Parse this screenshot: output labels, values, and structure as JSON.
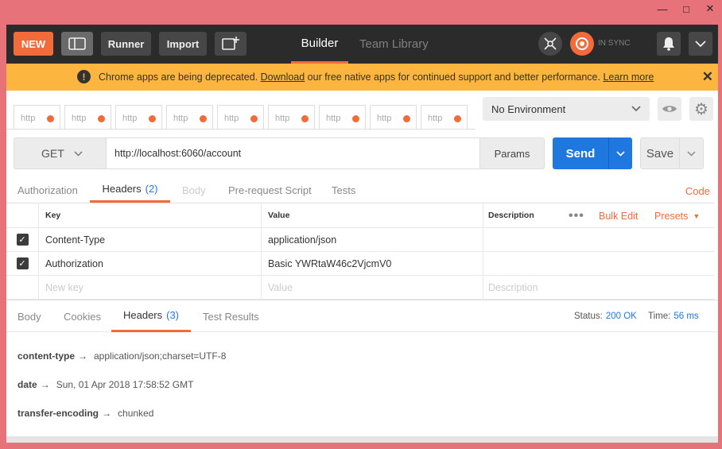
{
  "window": {
    "minimize": "—",
    "maximize": "□",
    "close": "✕"
  },
  "topbar": {
    "new_label": "NEW",
    "runner_label": "Runner",
    "import_label": "Import",
    "tabs": [
      "Builder",
      "Team Library"
    ],
    "sync_label": "IN SYNC"
  },
  "banner": {
    "text_before": "Chrome apps are being deprecated. ",
    "link_download": "Download",
    "text_middle": " our free native apps for continued support and better performance. ",
    "link_learn": "Learn more"
  },
  "request_tabs": [
    "http",
    "http",
    "http",
    "http",
    "http",
    "http",
    "http",
    "http",
    "http"
  ],
  "environment": {
    "selected": "No Environment"
  },
  "request": {
    "method": "GET",
    "url": "http://localhost:6060/account",
    "params_label": "Params",
    "send_label": "Send",
    "save_label": "Save"
  },
  "request_sections": {
    "authorization": "Authorization",
    "headers": "Headers",
    "headers_count": "(2)",
    "body": "Body",
    "prerequest": "Pre-request Script",
    "tests": "Tests",
    "code": "Code"
  },
  "headers_table": {
    "col_key": "Key",
    "col_value": "Value",
    "col_description": "Description",
    "more": "•••",
    "bulk_edit": "Bulk Edit",
    "presets": "Presets",
    "rows": [
      {
        "key": "Content-Type",
        "value": "application/json",
        "description": ""
      },
      {
        "key": "Authorization",
        "value": "Basic YWRtaW46c2VjcmV0",
        "description": ""
      }
    ],
    "new_row": {
      "key": "New key",
      "value": "Value",
      "description": "Description"
    }
  },
  "response": {
    "tabs": {
      "body": "Body",
      "cookies": "Cookies",
      "headers": "Headers",
      "headers_count": "(3)",
      "test_results": "Test Results"
    },
    "status_label": "Status:",
    "status_value": "200 OK",
    "time_label": "Time:",
    "time_value": "56 ms",
    "headers": [
      {
        "key": "content-type",
        "value": "application/json;charset=UTF-8"
      },
      {
        "key": "date",
        "value": "Sun, 01 Apr 2018 17:58:52 GMT"
      },
      {
        "key": "transfer-encoding",
        "value": "chunked"
      }
    ]
  },
  "colors": {
    "accent": "#f26b3a",
    "send_blue": "#1f77e0",
    "banner": "#fcb53e",
    "topbar": "#2b2b2b",
    "window_frame": "#e8727a"
  }
}
